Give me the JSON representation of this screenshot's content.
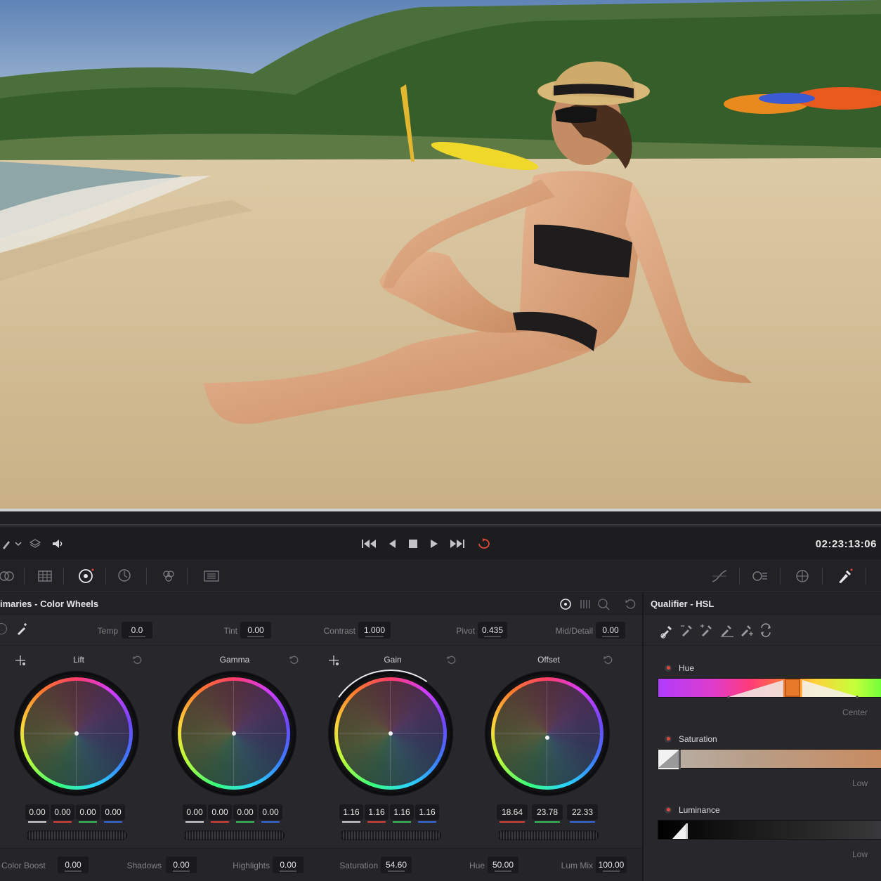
{
  "transport": {
    "timecode": "02:23:13:06",
    "buttons": [
      "skip-to-start",
      "step-back",
      "stop",
      "play",
      "skip-to-end",
      "loop"
    ]
  },
  "color_wheels": {
    "title": "imaries - Color Wheels",
    "params_top": [
      {
        "label": "Temp",
        "value": "0.0"
      },
      {
        "label": "Tint",
        "value": "0.00"
      },
      {
        "label": "Contrast",
        "value": "1.000"
      },
      {
        "label": "Pivot",
        "value": "0.435"
      },
      {
        "label": "Mid/Detail",
        "value": "0.00"
      }
    ],
    "wheels": [
      {
        "name": "Lift",
        "values": [
          "0.00",
          "0.00",
          "0.00",
          "0.00"
        ]
      },
      {
        "name": "Gamma",
        "values": [
          "0.00",
          "0.00",
          "0.00",
          "0.00"
        ]
      },
      {
        "name": "Gain",
        "values": [
          "1.16",
          "1.16",
          "1.16",
          "1.16"
        ]
      },
      {
        "name": "Offset",
        "values": [
          "18.64",
          "23.78",
          "22.33"
        ]
      }
    ],
    "params_bottom": [
      {
        "label": "Color Boost",
        "value": "0.00"
      },
      {
        "label": "Shadows",
        "value": "0.00"
      },
      {
        "label": "Highlights",
        "value": "0.00"
      },
      {
        "label": "Saturation",
        "value": "54.60"
      },
      {
        "label": "Hue",
        "value": "50.00"
      },
      {
        "label": "Lum Mix",
        "value": "100.00"
      }
    ]
  },
  "qualifier": {
    "title": "Qualifier - HSL",
    "hue_label": "Hue",
    "center_label": "Center",
    "saturation_label": "Saturation",
    "sat_low_label": "Low",
    "luminance_label": "Luminance",
    "lum_low_label": "Low"
  },
  "colors": {
    "accent_orange": "#e8782a",
    "loop_red": "#e0483a",
    "channel_red": "#e0403a",
    "channel_green": "#3ac05a",
    "channel_blue": "#3a6ae0"
  }
}
